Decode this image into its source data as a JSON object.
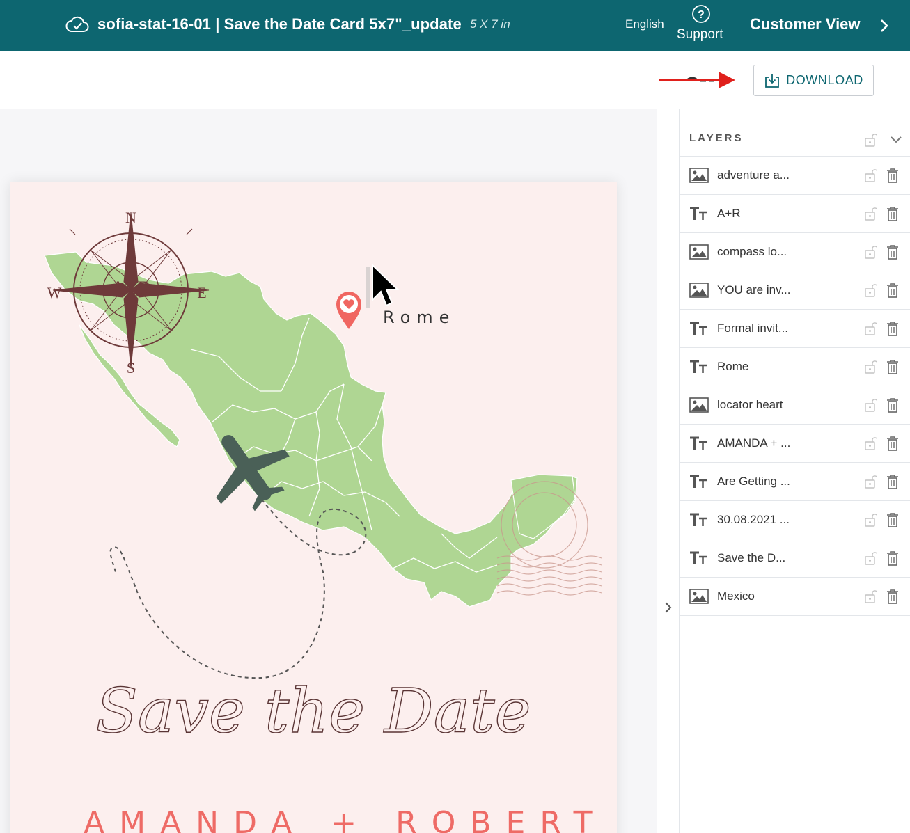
{
  "header": {
    "title": "sofia-stat-16-01 | Save the Date Card 5x7\"_update",
    "size": "5 X 7 in",
    "language": "English",
    "support_label": "Support",
    "customer_view": "Customer View"
  },
  "toolbar": {
    "download_label": "DOWNLOAD"
  },
  "card": {
    "compass_monogram": "A+R",
    "compass_n": "N",
    "compass_s": "S",
    "compass_e": "E",
    "compass_w": "W",
    "location": "Rome",
    "couple": "AMANDA + ROBERT",
    "script_heading": "Save the Date"
  },
  "layers": {
    "title": "LAYERS",
    "items": [
      {
        "type": "image",
        "label": "adventure a..."
      },
      {
        "type": "text",
        "label": "A+R"
      },
      {
        "type": "image",
        "label": "compass lo..."
      },
      {
        "type": "image",
        "label": "YOU are inv..."
      },
      {
        "type": "text",
        "label": "Formal invit..."
      },
      {
        "type": "text",
        "label": "Rome"
      },
      {
        "type": "image",
        "label": "locator heart"
      },
      {
        "type": "text",
        "label": "AMANDA + ..."
      },
      {
        "type": "text",
        "label": "Are Getting ..."
      },
      {
        "type": "text",
        "label": "30.08.2021 ..."
      },
      {
        "type": "text",
        "label": "Save the  D..."
      },
      {
        "type": "image",
        "label": "Mexico"
      }
    ]
  },
  "colors": {
    "brand": "#0d6670",
    "map_fill": "#afd693",
    "accent_coral": "#ee6b66",
    "compass_brown": "#6e3a3a",
    "annotation_red": "#e0201c"
  }
}
